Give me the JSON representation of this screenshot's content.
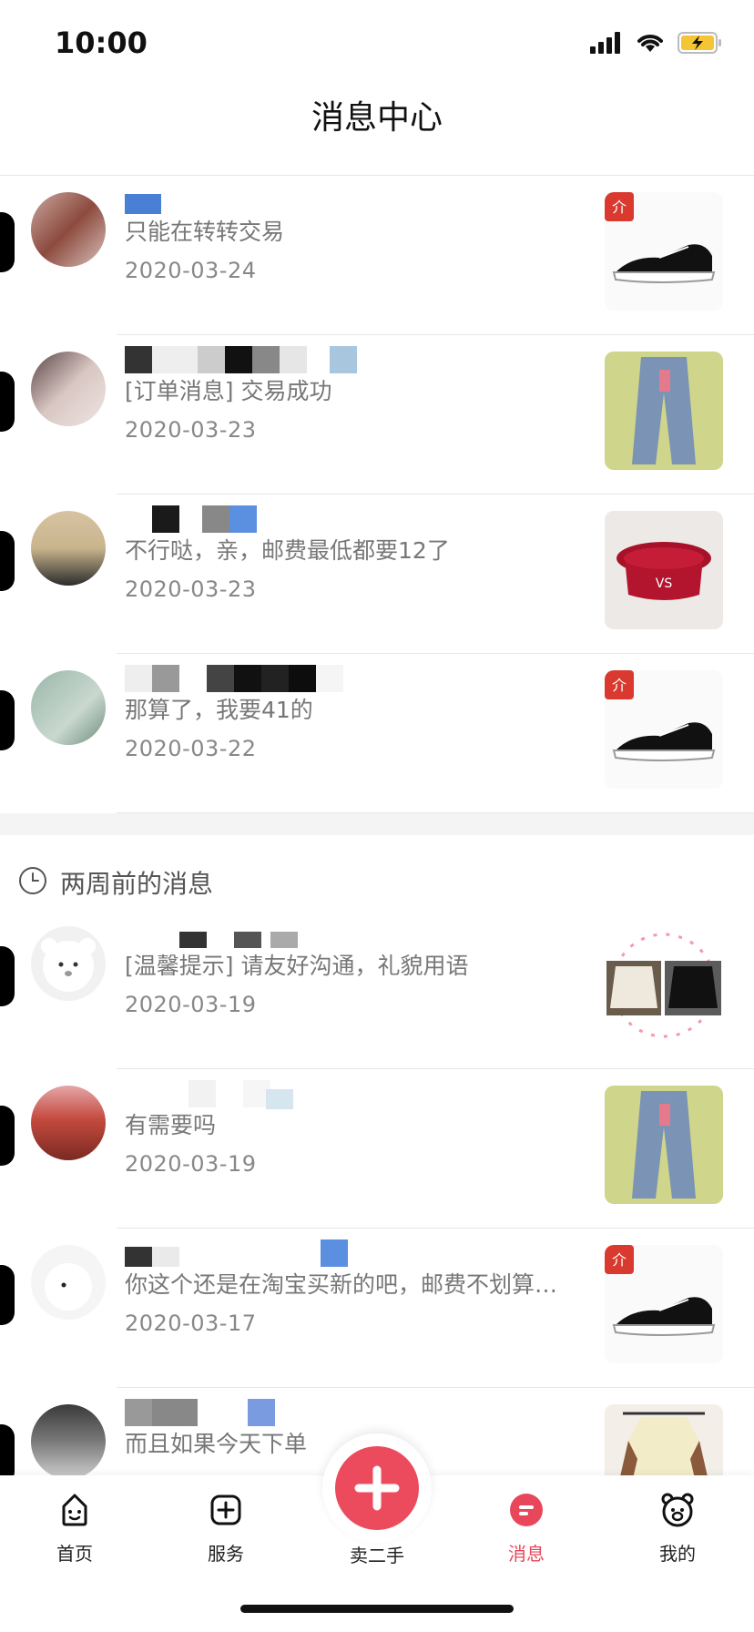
{
  "status_bar": {
    "time": "10:00",
    "icons": [
      "cellular-signal-icon",
      "wifi-icon",
      "battery-charging-icon"
    ]
  },
  "header": {
    "title": "消息中心"
  },
  "recent_messages": [
    {
      "preview": "只能在转转交易",
      "date": "2020-03-24",
      "thumb": "sneaker"
    },
    {
      "preview": "[订单消息] 交易成功",
      "date": "2020-03-23",
      "thumb": "jeans"
    },
    {
      "preview": "不行哒，亲，邮费最低都要12了",
      "date": "2020-03-23",
      "thumb": "red-hat"
    },
    {
      "preview": "那算了，我要41的",
      "date": "2020-03-22",
      "thumb": "sneaker"
    }
  ],
  "older_section": {
    "title": "两周前的消息",
    "icon": "clock-icon"
  },
  "older_messages": [
    {
      "preview": "[温馨提示] 请友好沟通，礼貌用语",
      "date": "2020-03-19",
      "thumb": "skirts"
    },
    {
      "preview": "有需要吗",
      "date": "2020-03-19",
      "thumb": "jeans"
    },
    {
      "preview": "你这个还是在淘宝买新的吧，邮费不划算…",
      "date": "2020-03-17",
      "thumb": "sneaker"
    },
    {
      "preview": "而且如果今天下单",
      "date": "",
      "thumb": "sweater"
    }
  ],
  "tab_bar": {
    "tabs": [
      {
        "label": "首页",
        "icon": "home-face-icon"
      },
      {
        "label": "服务",
        "icon": "service-plus-icon"
      },
      {
        "label": "卖二手",
        "icon": "sell-plus-icon"
      },
      {
        "label": "消息",
        "icon": "message-icon",
        "active": true
      },
      {
        "label": "我的",
        "icon": "bear-profile-icon"
      }
    ]
  },
  "colors": {
    "accent": "#ec4b5e",
    "active_tab": "#e8465a",
    "text_secondary": "#888888",
    "divider": "#e6e6e6"
  }
}
